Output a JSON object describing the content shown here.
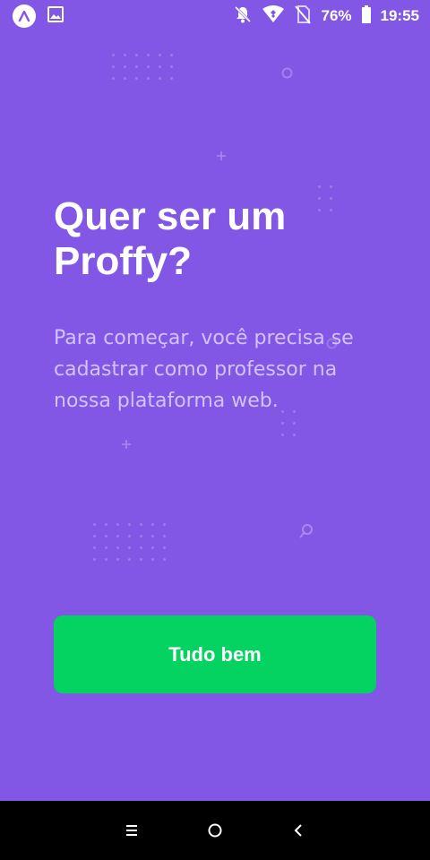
{
  "status_bar": {
    "battery_percent": "76%",
    "time": "19:55",
    "icons": [
      "app-launcher-icon",
      "gallery-icon",
      "notifications-off-icon",
      "wifi-icon",
      "no-sim-icon",
      "battery-icon"
    ]
  },
  "main": {
    "title": "Quer ser um Proffy?",
    "description": "Para começar, você precisa se cadastrar como professor na nossa plataforma web.",
    "button_label": "Tudo bem"
  },
  "nav_bar": {
    "icons": [
      "recent-apps-icon",
      "home-icon",
      "back-icon"
    ]
  },
  "colors": {
    "background": "#8257E5",
    "description_text": "#D4C2FF",
    "button": "#04D361",
    "text": "#FFFFFF"
  }
}
